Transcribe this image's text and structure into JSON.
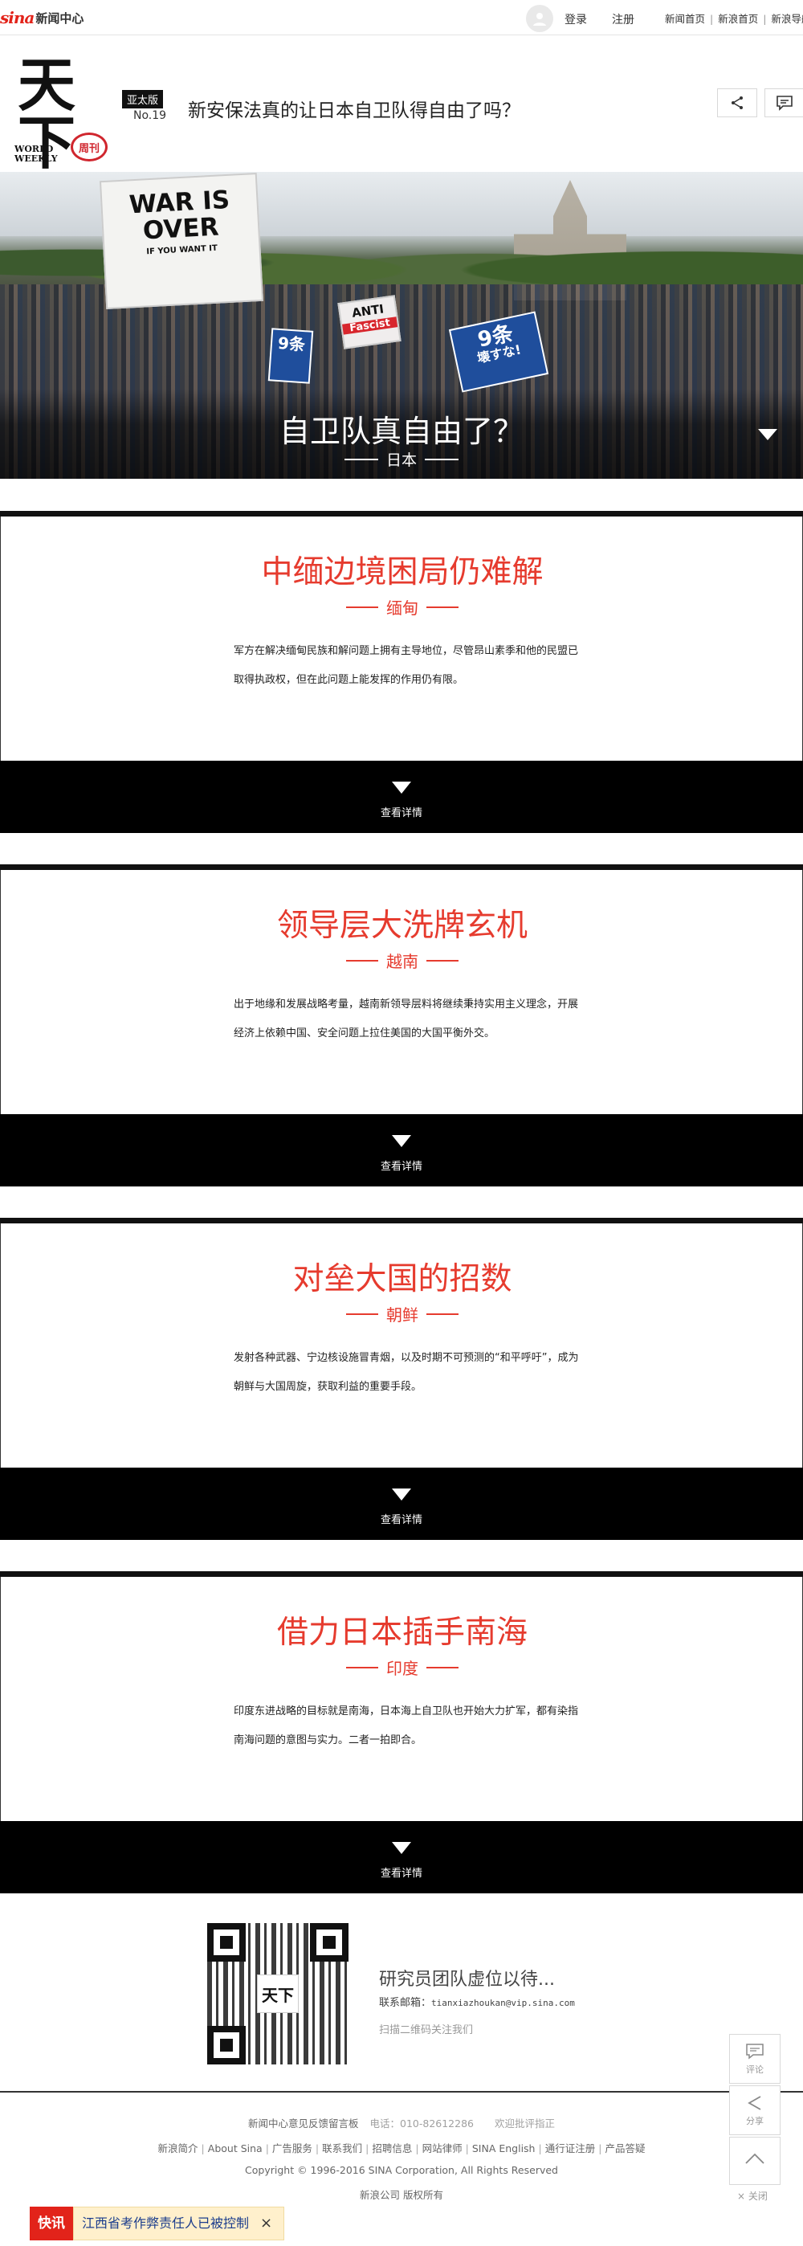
{
  "topbar": {
    "logo_brand": "sina",
    "logo_center": "新闻中心",
    "login": "登录",
    "register": "注册",
    "nav": [
      "新闻首页",
      "新浪首页",
      "新浪导航"
    ]
  },
  "masthead": {
    "logo_main": "天下",
    "logo_world": "WORLD",
    "logo_weekly": "WEEKLY",
    "logo_seal": "周刊",
    "edition": "亚太版",
    "issue": "No.19",
    "headline": "新安保法真的让日本自卫队得自由了吗？"
  },
  "hero": {
    "title": "自卫队真自由了？",
    "subtitle": "日本",
    "signs": {
      "war": "WAR IS OVER",
      "war_small": "IF YOU WANT IT",
      "anti": "ANTI",
      "anti_sub": "Fascist",
      "k9_big": "9条",
      "k9_small": "壊すな!",
      "k9b": "9条"
    }
  },
  "cards": [
    {
      "title": "中缅边境困局仍难解",
      "country": "缅甸",
      "desc": "军方在解决缅甸民族和解问题上拥有主导地位，尽管昂山素季和他的民盟已取得执政权，但在此问题上能发挥的作用仍有限。",
      "more": "查看详情"
    },
    {
      "title": "领导层大洗牌玄机",
      "country": "越南",
      "desc": "出于地缘和发展战略考量，越南新领导层料将继续秉持实用主义理念，开展经济上依赖中国、安全问题上拉住美国的大国平衡外交。",
      "more": "查看详情"
    },
    {
      "title": "对垒大国的招数",
      "country": "朝鲜",
      "desc": "发射各种武器、宁边核设施冒青烟，以及时期不可预测的“和平呼吁”，成为朝鲜与大国周旋，获取利益的重要手段。",
      "more": "查看详情"
    },
    {
      "title": "借力日本插手南海",
      "country": "印度",
      "desc": "印度东进战略的目标就是南海，日本海上自卫队也开始大力扩军，都有染指南海问题的意图与实力。二者一拍即合。",
      "more": "查看详情"
    }
  ],
  "promo": {
    "qr_logo": "天下",
    "title": "研究员团队虚位以待...",
    "mail_label": "联系邮箱：",
    "mail": "tianxiazhoukan@vip.sina.com",
    "scan": "扫描二维码关注我们"
  },
  "footer": {
    "line1_a": "新闻中心意见反馈留言板",
    "line1_b": "电话：010-82612286",
    "line1_c": "欢迎批评指正",
    "links": [
      "新浪简介",
      "About Sina",
      "广告服务",
      "联系我们",
      "招聘信息",
      "网站律师",
      "SINA English",
      "通行证注册",
      "产品答疑"
    ],
    "copyright": "Copyright © 1996-2016 SINA Corporation, All Rights Reserved",
    "owner": "新浪公司 版权所有"
  },
  "side": {
    "comment": "评论",
    "share": "分享",
    "close": "关闭"
  },
  "breaking": {
    "tag": "快讯",
    "text": "江西省考作弊责任人已被控制"
  },
  "colors": {
    "accent_red": "#e63b2e",
    "brand_red": "#e2231a",
    "dark": "#000000"
  }
}
